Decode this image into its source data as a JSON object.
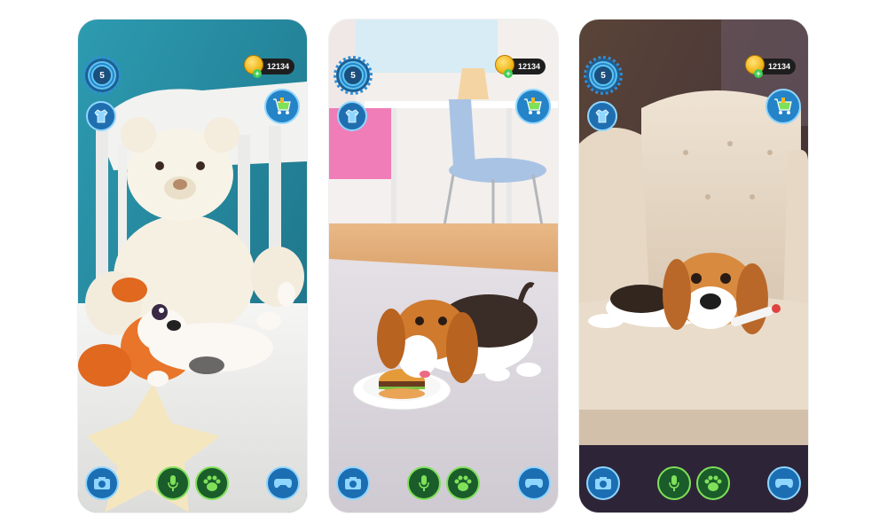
{
  "screens": [
    {
      "id": "screen-1",
      "scene": "teddy-bear-bed",
      "level": "5",
      "coins": "12134"
    },
    {
      "id": "screen-2",
      "scene": "rug-burger",
      "level": "5",
      "coins": "12134"
    },
    {
      "id": "screen-3",
      "scene": "armchair-thermometer",
      "level": "5",
      "coins": "12134"
    }
  ],
  "icons": {
    "level": "level-badge-icon",
    "coin": "coin-icon",
    "add": "plus-icon",
    "wardrobe": "shirt-icon",
    "shop": "shopping-cart-icon",
    "camera": "camera-icon",
    "microphone": "microphone-icon",
    "paw": "paw-icon",
    "gamepad": "gamepad-icon"
  },
  "colors": {
    "hud_blue": "#1f6fb0",
    "hud_green": "#1a5d2a",
    "coin_gold": "#f2b71b",
    "plus_green": "#3fcf55"
  }
}
